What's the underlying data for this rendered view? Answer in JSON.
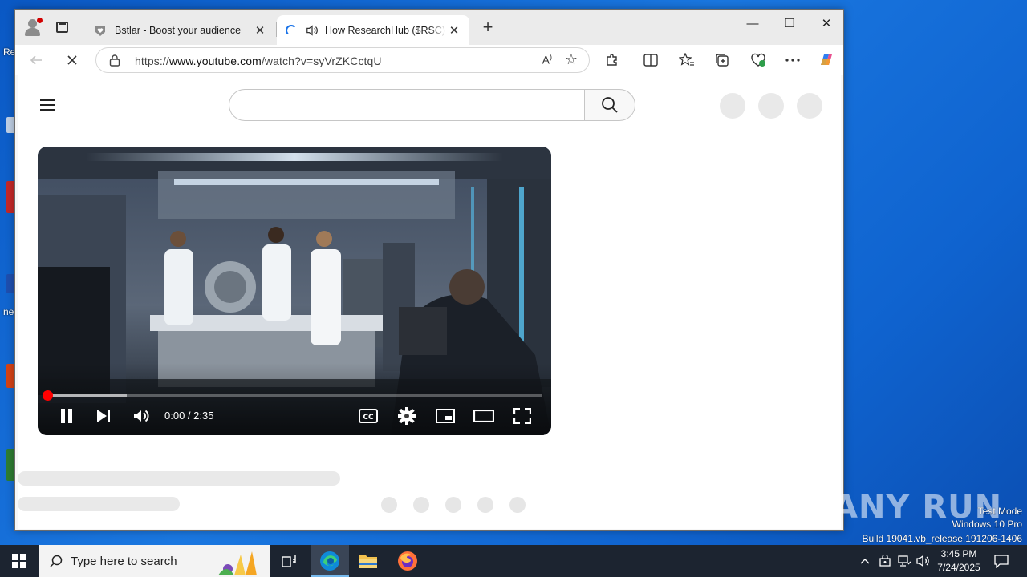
{
  "desktop": {
    "fragments": [
      "Re",
      "ne"
    ],
    "watermark": "ANY RUN",
    "system_info": [
      "Test Mode",
      "Windows 10 Pro",
      "Build 19041.vb_release.191206-1406"
    ]
  },
  "browser": {
    "tabs": [
      {
        "title": "Bstlar - Boost your audience",
        "favicon": "heart-shield-icon",
        "state": "inactive"
      },
      {
        "title": "How ResearchHub ($RSC) Is Transforming Science",
        "favicon": "loading-spinner",
        "audio": "speaker-icon",
        "state": "active"
      }
    ],
    "new_tab": "+",
    "window_controls": {
      "minimize": "—",
      "maximize": "☐",
      "close": "✕"
    },
    "address": {
      "scheme": "https://",
      "host": "www.youtube.com",
      "path": "/watch?v=syVrZKCctqU"
    },
    "read_aloud": "A",
    "favorite": "☆"
  },
  "youtube": {
    "search": {
      "placeholder": ""
    },
    "player": {
      "time": "0:00 / 2:35",
      "progress_fraction": 0.0,
      "buffered_fraction": 0.16
    }
  },
  "taskbar": {
    "search_placeholder": "Type here to search",
    "clock_time": "3:45 PM",
    "clock_date": "7/24/2025"
  },
  "colors": {
    "accent_red": "#ff0000",
    "spinner_blue": "#1a73e8",
    "desktop_blue": "#1a77e0"
  }
}
